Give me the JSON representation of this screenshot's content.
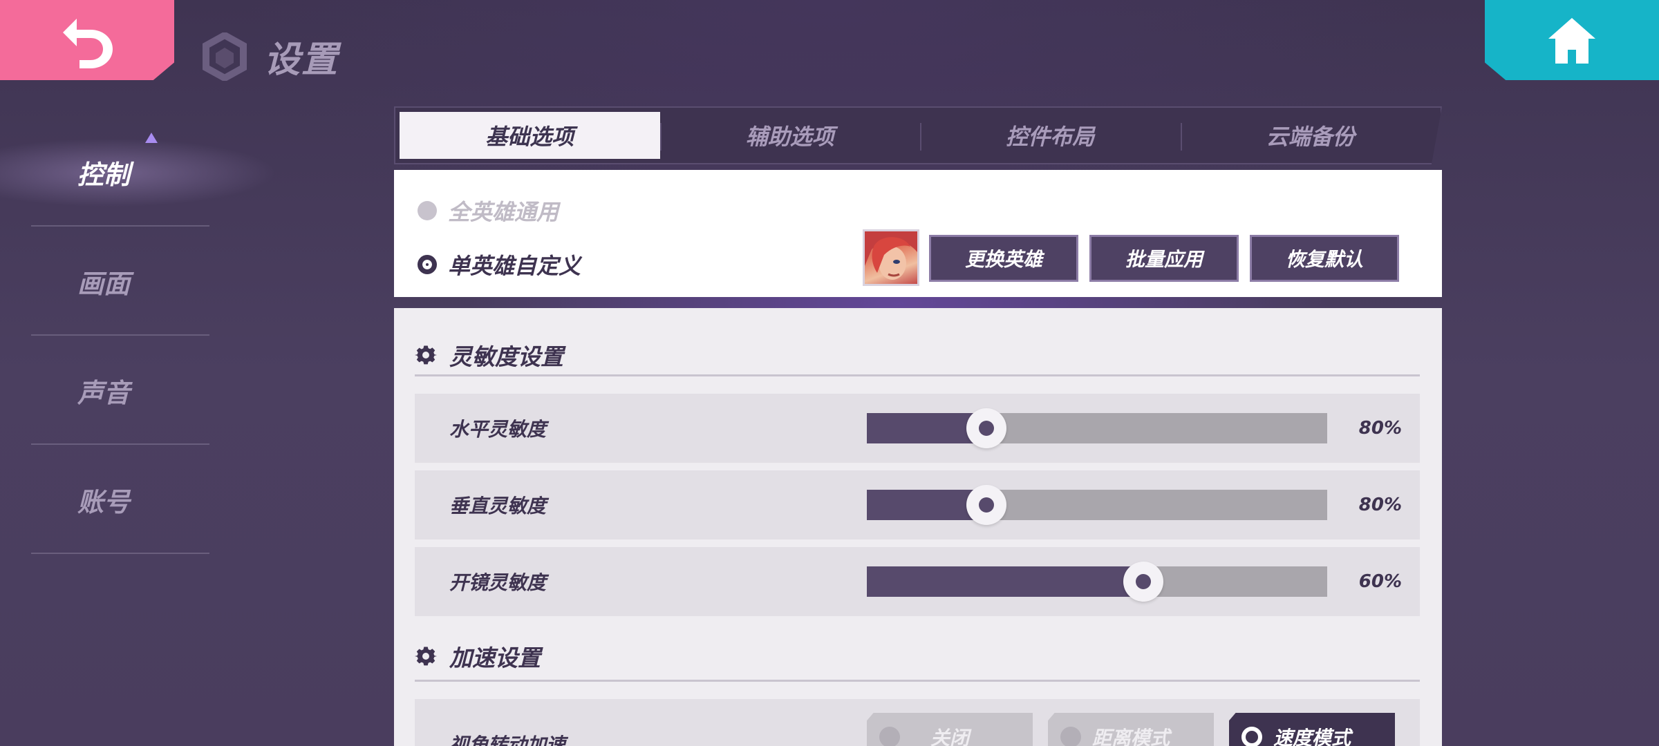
{
  "header": {
    "title": "设置"
  },
  "sidebar": {
    "items": [
      {
        "label": "控制",
        "active": true
      },
      {
        "label": "画面"
      },
      {
        "label": "声音"
      },
      {
        "label": "账号"
      }
    ]
  },
  "tabs": [
    {
      "label": "基础选项",
      "active": true
    },
    {
      "label": "辅助选项"
    },
    {
      "label": "控件布局"
    },
    {
      "label": "云端备份"
    }
  ],
  "hero_mode": {
    "options": [
      {
        "label": "全英雄通用",
        "selected": false
      },
      {
        "label": "单英雄自定义",
        "selected": true
      }
    ],
    "buttons": {
      "change_hero": "更换英雄",
      "batch_apply": "批量应用",
      "restore_default": "恢复默认"
    }
  },
  "sensitivity": {
    "title": "灵敏度设置",
    "rows": [
      {
        "label": "水平灵敏度",
        "value": "80%",
        "fraction": 0.26
      },
      {
        "label": "垂直灵敏度",
        "value": "80%",
        "fraction": 0.26
      },
      {
        "label": "开镜灵敏度",
        "value": "60%",
        "fraction": 0.6
      }
    ]
  },
  "acceleration": {
    "title": "加速设置",
    "row_label": "视角转动加速",
    "options": [
      {
        "label": "关闭",
        "selected": false
      },
      {
        "label": "距离模式",
        "selected": false
      },
      {
        "label": "速度模式",
        "selected": true
      }
    ]
  },
  "colors": {
    "back_button": "#f46b9a",
    "home_button": "#16b4c8",
    "accent_dark": "#3e3350",
    "slider_fill": "#574a6c"
  }
}
